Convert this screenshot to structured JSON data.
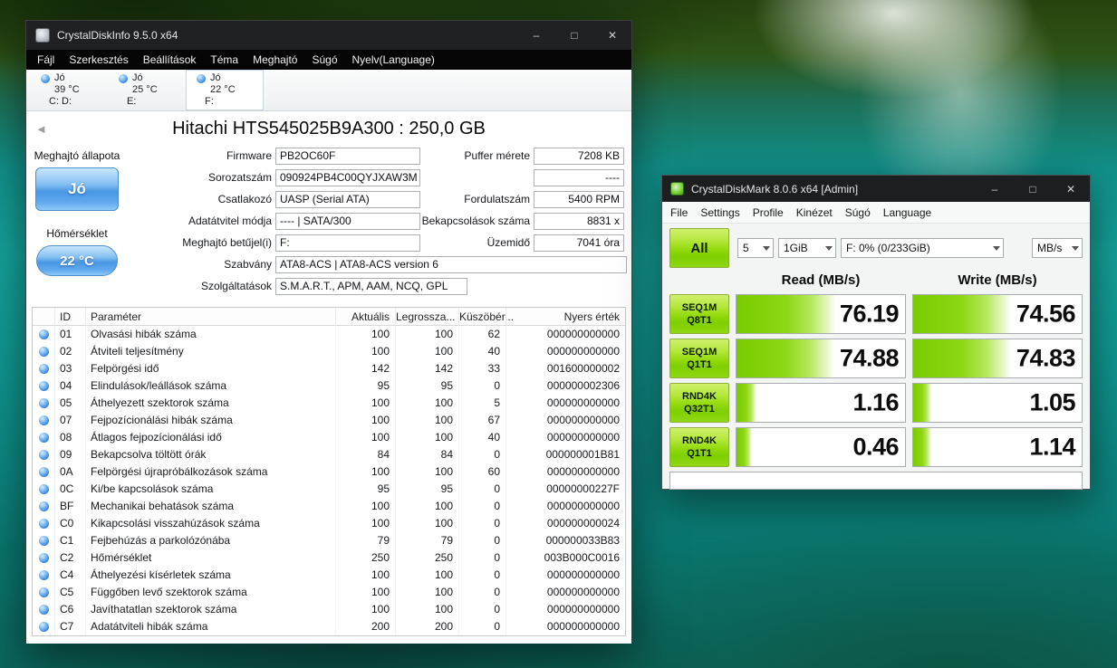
{
  "icons": {
    "minimize": "–",
    "maximize": "□",
    "close": "✕",
    "back": "◄"
  },
  "diskinfo": {
    "title": "CrystalDiskInfo 9.5.0 x64",
    "menu": [
      "Fájl",
      "Szerkesztés",
      "Beállítások",
      "Téma",
      "Meghajtó",
      "Súgó",
      "Nyelv(Language)"
    ],
    "drive_tabs": [
      {
        "status": "Jó",
        "temp": "39 °C",
        "letters": "C: D:",
        "selected": false
      },
      {
        "status": "Jó",
        "temp": "25 °C",
        "letters": "E:",
        "selected": false
      },
      {
        "status": "Jó",
        "temp": "22 °C",
        "letters": "F:",
        "selected": true
      }
    ],
    "model_title": "Hitachi HTS545025B9A300 : 250,0 GB",
    "health": {
      "label": "Meghajtó állapota",
      "value": "Jó"
    },
    "temperature": {
      "label": "Hőmérséklet",
      "value": "22 °C"
    },
    "fields_left": [
      {
        "label": "Firmware",
        "value": "PB2OC60F"
      },
      {
        "label": "Sorozatszám",
        "value": "090924PB4C00QYJXAW3M"
      },
      {
        "label": "Csatlakozó",
        "value": "UASP (Serial ATA)"
      },
      {
        "label": "Adatátvitel módja",
        "value": "---- | SATA/300"
      },
      {
        "label": "Meghajtó betűjel(i)",
        "value": "F:"
      }
    ],
    "fields_right": [
      {
        "label": "Puffer mérete",
        "value": "7208 KB"
      },
      {
        "label": "",
        "value": "----"
      },
      {
        "label": "Fordulatszám",
        "value": "5400 RPM"
      },
      {
        "label": "Bekapcsolások száma",
        "value": "8831 x"
      },
      {
        "label": "Üzemidő",
        "value": "7041 óra"
      }
    ],
    "fields_wide": [
      {
        "label": "Szabvány",
        "value": "ATA8-ACS | ATA8-ACS version 6"
      },
      {
        "label": "Szolgáltatások",
        "value": "S.M.A.R.T., APM, AAM, NCQ, GPL"
      }
    ],
    "smart_table": {
      "headers": {
        "id": "ID",
        "param": "Paraméter",
        "current": "Aktuális",
        "worst": "Legrossza...",
        "threshold": "Küszöbér...",
        "raw": "Nyers érték"
      },
      "rows": [
        {
          "id": "01",
          "name": "Olvasási hibák száma",
          "current": "100",
          "worst": "100",
          "threshold": "62",
          "raw": "000000000000"
        },
        {
          "id": "02",
          "name": "Átviteli teljesítmény",
          "current": "100",
          "worst": "100",
          "threshold": "40",
          "raw": "000000000000"
        },
        {
          "id": "03",
          "name": "Felpörgési idő",
          "current": "142",
          "worst": "142",
          "threshold": "33",
          "raw": "001600000002"
        },
        {
          "id": "04",
          "name": "Elindulások/leállások száma",
          "current": "95",
          "worst": "95",
          "threshold": "0",
          "raw": "000000002306"
        },
        {
          "id": "05",
          "name": "Áthelyezett szektorok száma",
          "current": "100",
          "worst": "100",
          "threshold": "5",
          "raw": "000000000000"
        },
        {
          "id": "07",
          "name": "Fejpozícionálási hibák száma",
          "current": "100",
          "worst": "100",
          "threshold": "67",
          "raw": "000000000000"
        },
        {
          "id": "08",
          "name": "Átlagos fejpozícionálási idő",
          "current": "100",
          "worst": "100",
          "threshold": "40",
          "raw": "000000000000"
        },
        {
          "id": "09",
          "name": "Bekapcsolva töltött órák",
          "current": "84",
          "worst": "84",
          "threshold": "0",
          "raw": "000000001B81"
        },
        {
          "id": "0A",
          "name": "Felpörgési újrapróbálkozások száma",
          "current": "100",
          "worst": "100",
          "threshold": "60",
          "raw": "000000000000"
        },
        {
          "id": "0C",
          "name": "Ki/be kapcsolások száma",
          "current": "95",
          "worst": "95",
          "threshold": "0",
          "raw": "00000000227F"
        },
        {
          "id": "BF",
          "name": "Mechanikai behatások száma",
          "current": "100",
          "worst": "100",
          "threshold": "0",
          "raw": "000000000000"
        },
        {
          "id": "C0",
          "name": "Kikapcsolási visszahúzások száma",
          "current": "100",
          "worst": "100",
          "threshold": "0",
          "raw": "000000000024"
        },
        {
          "id": "C1",
          "name": "Fejbehúzás a parkolózónába",
          "current": "79",
          "worst": "79",
          "threshold": "0",
          "raw": "000000033B83"
        },
        {
          "id": "C2",
          "name": "Hőmérséklet",
          "current": "250",
          "worst": "250",
          "threshold": "0",
          "raw": "003B000C0016"
        },
        {
          "id": "C4",
          "name": "Áthelyezési kísérletek száma",
          "current": "100",
          "worst": "100",
          "threshold": "0",
          "raw": "000000000000"
        },
        {
          "id": "C5",
          "name": "Függőben levő szektorok száma",
          "current": "100",
          "worst": "100",
          "threshold": "0",
          "raw": "000000000000"
        },
        {
          "id": "C6",
          "name": "Javíthatatlan szektorok száma",
          "current": "100",
          "worst": "100",
          "threshold": "0",
          "raw": "000000000000"
        },
        {
          "id": "C7",
          "name": "Adatátviteli hibák száma",
          "current": "200",
          "worst": "200",
          "threshold": "0",
          "raw": "000000000000"
        }
      ]
    }
  },
  "diskmark": {
    "title": "CrystalDiskMark 8.0.6 x64 [Admin]",
    "menu": [
      "File",
      "Settings",
      "Profile",
      "Kinézet",
      "Súgó",
      "Language"
    ],
    "controls": {
      "all_label": "All",
      "count_value": "5",
      "size_value": "1GiB",
      "target_value": "F: 0% (0/233GiB)",
      "unit_value": "MB/s"
    },
    "columns": {
      "read": "Read (MB/s)",
      "write": "Write (MB/s)"
    },
    "tests": [
      {
        "line1": "SEQ1M",
        "line2": "Q8T1",
        "read": "76.19",
        "write": "74.56",
        "read_pct": 59,
        "write_pct": 58
      },
      {
        "line1": "SEQ1M",
        "line2": "Q1T1",
        "read": "74.88",
        "write": "74.83",
        "read_pct": 58,
        "write_pct": 58
      },
      {
        "line1": "RND4K",
        "line2": "Q32T1",
        "read": "1.16",
        "write": "1.05",
        "read_pct": 12,
        "write_pct": 11
      },
      {
        "line1": "RND4K",
        "line2": "Q1T1",
        "read": "0.46",
        "write": "1.14",
        "read_pct": 9,
        "write_pct": 11
      }
    ],
    "message": ""
  }
}
